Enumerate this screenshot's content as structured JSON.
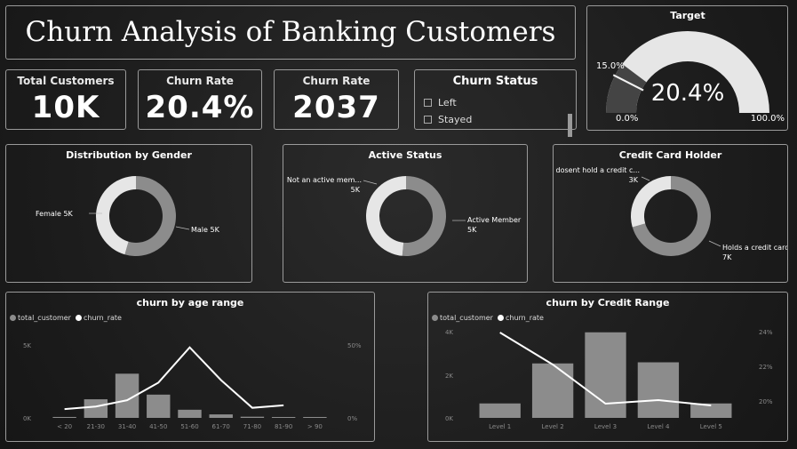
{
  "title": "Churn Analysis of Banking Customers",
  "kpis": [
    {
      "label": "Total Customers",
      "value": "10K"
    },
    {
      "label": "Churn Rate",
      "value": "20.4%"
    },
    {
      "label": "Churn Rate",
      "value": "2037"
    }
  ],
  "slicer": {
    "title": "Churn Status",
    "options": [
      "Left",
      "Stayed"
    ]
  },
  "gauge": {
    "title": "Target",
    "value": 20.4,
    "value_label": "20.4%",
    "target": 15.0,
    "target_label": "15.0%",
    "min_label": "0.0%",
    "max_label": "100.0%"
  },
  "donuts": {
    "gender": {
      "title": "Distribution by Gender",
      "a_label": "Female 5K",
      "b_label": "Male 5K",
      "a_share": 0.455
    },
    "active": {
      "title": "Active Status",
      "a_label": "Not an active mem...",
      "a_value": "5K",
      "b_label": "Active Member",
      "b_value": "5K",
      "a_share": 0.485
    },
    "credit": {
      "title": "Credit Card Holder",
      "a_label": "dosent hold a credit c...",
      "a_value": "3K",
      "b_label": "Holds a credit card",
      "b_value": "7K",
      "a_share": 0.295
    }
  },
  "legend": {
    "total": "total_customer",
    "rate": "churn_rate"
  },
  "colors": {
    "bar": "#8c8c8c",
    "line": "#ffffff",
    "donut_light": "#e6e6e6",
    "donut_dark": "#8c8c8c"
  },
  "chart_data": [
    {
      "type": "bar",
      "title": "churn by age range",
      "categories": [
        "< 20",
        "21-30",
        "31-40",
        "41-50",
        "51-60",
        "61-70",
        "71-80",
        "81-90",
        "> 90"
      ],
      "series": [
        {
          "name": "total_customer",
          "type": "bar",
          "values": [
            80,
            1600,
            3800,
            2000,
            700,
            300,
            100,
            40,
            10
          ]
        },
        {
          "name": "churn_rate",
          "type": "line",
          "values": [
            7,
            9,
            14,
            28,
            56,
            30,
            8,
            10,
            null
          ]
        }
      ],
      "y_ticks": [
        "5K",
        "0K"
      ],
      "y_max": 6500,
      "y2_ticks": [
        "50%",
        "0%"
      ],
      "y2_max": 60
    },
    {
      "type": "bar",
      "title": "churn by Credit Range",
      "categories": [
        "Level 1",
        "Level 2",
        "Level 3",
        "Level 4",
        "Level 5"
      ],
      "series": [
        {
          "name": "total_customer",
          "type": "bar",
          "values": [
            650,
            2450,
            3850,
            2500,
            650
          ]
        },
        {
          "name": "churn_rate",
          "type": "line",
          "values": [
            23.8,
            22.0,
            19.8,
            20.0,
            19.7
          ]
        }
      ],
      "y_ticks": [
        "4K",
        "2K",
        "0K"
      ],
      "y_max": 4000,
      "y2_ticks": [
        "24%",
        "22%",
        "20%"
      ],
      "y2_min": 19,
      "y2_max": 24
    }
  ]
}
